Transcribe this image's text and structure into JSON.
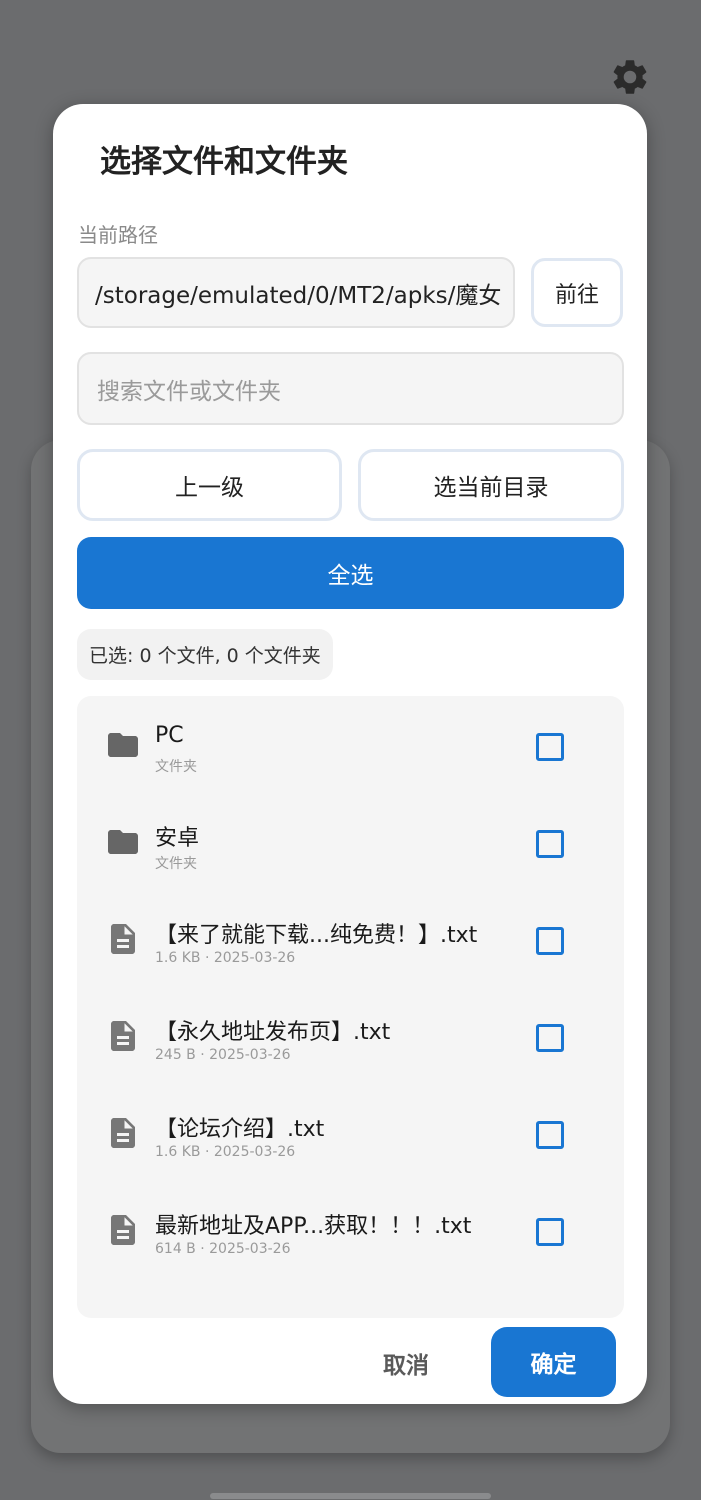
{
  "dialog": {
    "title": "选择文件和文件夹",
    "path_label": "当前路径",
    "path_value": "/storage/emulated/0/MT2/apks/魔女",
    "go_label": "前往",
    "search_placeholder": "搜索文件或文件夹",
    "up_label": "上一级",
    "select_current_dir_label": "选当前目录",
    "select_all_label": "全选",
    "selected_summary": "已选: 0 个文件, 0 个文件夹",
    "cancel_label": "取消",
    "confirm_label": "确定"
  },
  "files": [
    {
      "name": "PC",
      "meta": "文件夹",
      "icon": "folder-icon",
      "checked": false
    },
    {
      "name": "安卓",
      "meta": "文件夹",
      "icon": "folder-icon",
      "checked": false
    },
    {
      "name": "【来了就能下载...纯免费！】.txt",
      "meta": "1.6 KB · 2025-03-26",
      "icon": "file-text-icon",
      "checked": false
    },
    {
      "name": "【永久地址发布页】.txt",
      "meta": "245 B · 2025-03-26",
      "icon": "file-text-icon",
      "checked": false
    },
    {
      "name": "【论坛介绍】.txt",
      "meta": "1.6 KB · 2025-03-26",
      "icon": "file-text-icon",
      "checked": false
    },
    {
      "name": "最新地址及APP...获取！！！.txt",
      "meta": "614 B · 2025-03-26",
      "icon": "file-text-icon",
      "checked": false
    }
  ],
  "colors": {
    "accent": "#1976d2",
    "icon": "#666666"
  },
  "icons": {
    "settings": "gear-icon"
  }
}
